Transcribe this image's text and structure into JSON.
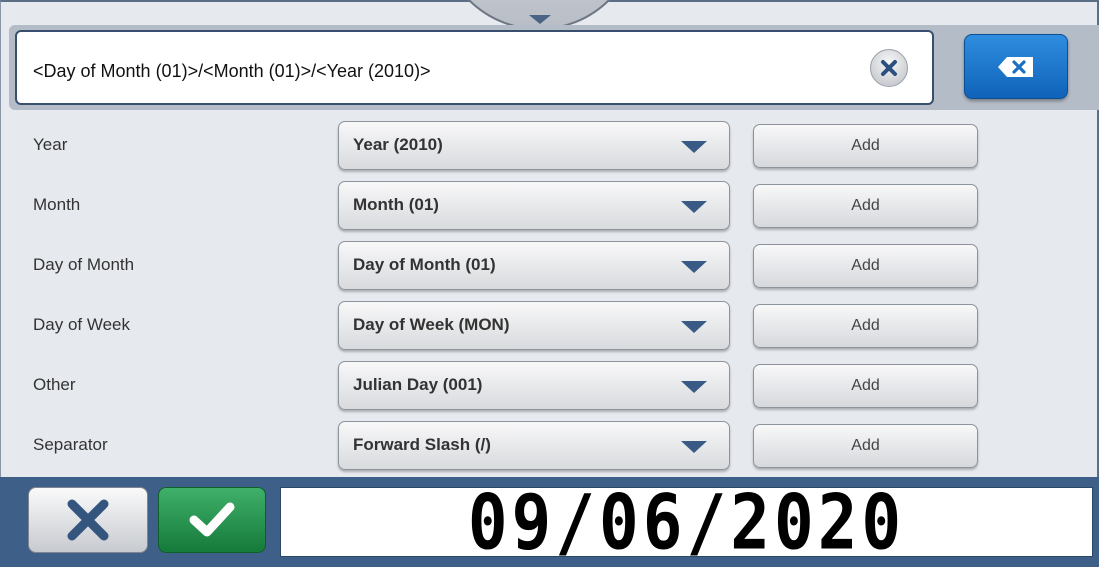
{
  "format_field": {
    "value": "<Day of Month (01)>/<Month (01)>/<Year (2010)>"
  },
  "icons": {
    "pull_tab": "chevron-down-icon",
    "clear": "close-icon",
    "backspace": "backspace-icon",
    "cancel": "close-icon",
    "confirm": "checkmark-icon"
  },
  "rows": [
    {
      "label": "Year",
      "selected": "Year (2010)",
      "add_label": "Add"
    },
    {
      "label": "Month",
      "selected": "Month (01)",
      "add_label": "Add"
    },
    {
      "label": "Day of Month",
      "selected": "Day of Month (01)",
      "add_label": "Add"
    },
    {
      "label": "Day of Week",
      "selected": "Day of Week (MON)",
      "add_label": "Add"
    },
    {
      "label": "Other",
      "selected": "Julian Day (001)",
      "add_label": "Add"
    },
    {
      "label": "Separator",
      "selected": "Forward Slash (/)",
      "add_label": "Add"
    }
  ],
  "preview": {
    "value": "09/06/2020"
  },
  "colors": {
    "accent_blue": "#1a74cc",
    "confirm_green": "#1f8a47",
    "footer": "#3d5f88",
    "arrow": "#3a5a86"
  }
}
